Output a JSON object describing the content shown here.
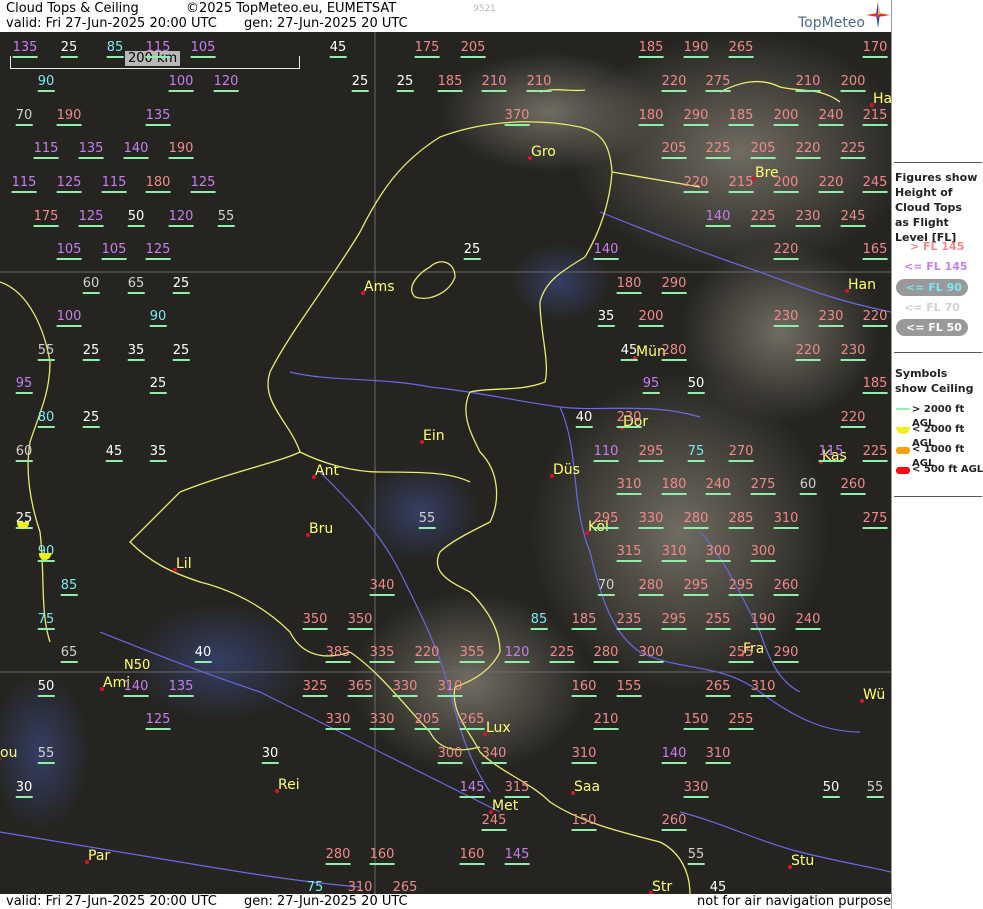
{
  "header": {
    "title": "Cloud Tops & Ceiling",
    "copyright": "©2025 TopMeteo.eu, EUMETSAT",
    "valid": "valid:  Fri  27-Jun-2025  20:00 UTC",
    "gen": "gen: 27-Jun-2025 20 UTC",
    "stamp": "9521",
    "logo": "TopMeteo"
  },
  "footer": {
    "valid": "valid:  Fri  27-Jun-2025  20:00 UTC",
    "gen": "gen: 27-Jun-2025 20 UTC",
    "disclaimer": "not for air navigation purposes"
  },
  "scale_label": "200 km",
  "grid_label": "N50",
  "colors": {
    "above145": "#f08a8a",
    "le145": "#c67ef0",
    "le90": "#7ae8f0",
    "le70": "#d0d0d0",
    "le50": "#ffffff",
    "underline": "#8ef0a8",
    "city": "#ffff70",
    "city_dot": "#e0102a",
    "border": "#eaea70",
    "river": "#6a6ae8"
  },
  "legend": {
    "figures_title": "Figures show Height of Cloud Tops as Flight Level  [FL]",
    "levels": [
      "> FL 145",
      "<= FL 145",
      "<= FL 90",
      "<= FL 70",
      "<= FL 50"
    ],
    "symbols_title": "Symbols show Ceiling",
    "symbols": [
      "> 2000 ft AGL",
      "< 2000 ft AGL",
      "< 1000 ft AGL",
      "< 500 ft AGL"
    ]
  },
  "cities": [
    "Gro",
    "Ams",
    "Bre",
    "Han",
    "Ha",
    "Mün",
    "Dor",
    "Ein",
    "Ant",
    "Düs",
    "Kas",
    "Köl",
    "Bru",
    "Lil",
    "Fra",
    "Ami",
    "Wü",
    "Lux",
    "Rei",
    "Saa",
    "Met",
    "Par",
    "Stu",
    "Str",
    "ou"
  ],
  "cloud_tops": [
    "135",
    "25",
    "85",
    "115",
    "105",
    "45",
    "175",
    "205",
    "185",
    "190",
    "265",
    "170",
    "90",
    "100",
    "120",
    "25",
    "25",
    "185",
    "210",
    "210",
    "220",
    "275",
    "210",
    "200",
    "70",
    "190",
    "135",
    "370",
    "180",
    "290",
    "185",
    "200",
    "240",
    "215",
    "115",
    "135",
    "140",
    "190",
    "205",
    "225",
    "205",
    "220",
    "225",
    "115",
    "125",
    "115",
    "180",
    "125",
    "220",
    "215",
    "200",
    "220",
    "245",
    "175",
    "125",
    "50",
    "120",
    "55",
    "140",
    "225",
    "230",
    "245",
    "105",
    "105",
    "125",
    "25",
    "140",
    "220",
    "165",
    "60",
    "65",
    "25",
    "180",
    "290",
    "100",
    "90",
    "35",
    "200",
    "230",
    "230",
    "220",
    "55",
    "25",
    "35",
    "25",
    "45",
    "280",
    "220",
    "230",
    "95",
    "25",
    "95",
    "50",
    "185",
    "80",
    "25",
    "40",
    "230",
    "220",
    "60",
    "45",
    "35",
    "110",
    "295",
    "75",
    "270",
    "115",
    "225",
    "310",
    "180",
    "240",
    "275",
    "60",
    "260",
    "25",
    "55",
    "295",
    "330",
    "280",
    "285",
    "310",
    "275",
    "90",
    "315",
    "310",
    "300",
    "300",
    "85",
    "340",
    "70",
    "280",
    "295",
    "295",
    "260",
    "75",
    "350",
    "350",
    "85",
    "185",
    "235",
    "295",
    "255",
    "190",
    "240",
    "65",
    "40",
    "385",
    "335",
    "220",
    "355",
    "120",
    "225",
    "280",
    "300",
    "255",
    "290",
    "50",
    "140",
    "135",
    "325",
    "365",
    "330",
    "310",
    "160",
    "155",
    "265",
    "310",
    "125",
    "330",
    "330",
    "205",
    "265",
    "210",
    "150",
    "255",
    "55",
    "30",
    "300",
    "340",
    "310",
    "140",
    "310",
    "30",
    "145",
    "315",
    "330",
    "50",
    "55",
    "245",
    "150",
    "260",
    "280",
    "160",
    "160",
    "145",
    "55",
    "75",
    "310",
    "265",
    "45"
  ]
}
